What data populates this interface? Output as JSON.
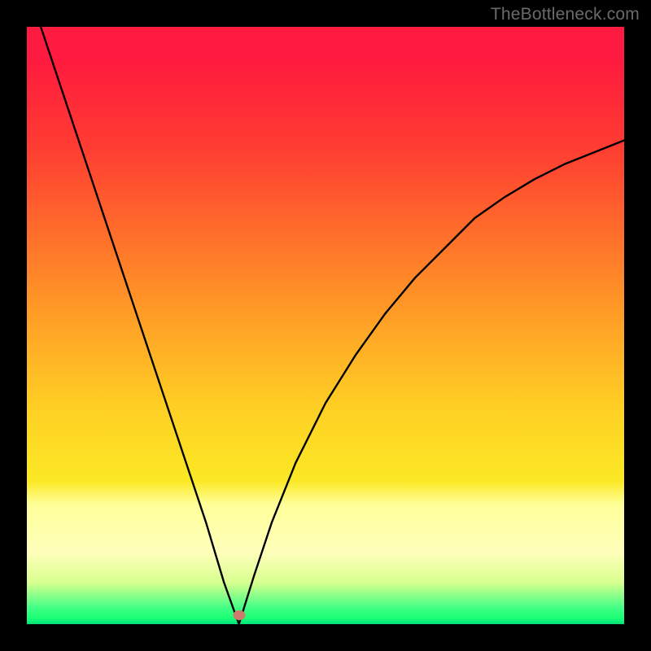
{
  "watermark": "TheBottleneck.com",
  "marker": {
    "x_frac": 0.355,
    "y_frac": 0.985,
    "color": "#cd7b6e"
  },
  "chart_data": {
    "type": "line",
    "title": "",
    "xlabel": "",
    "ylabel": "",
    "xlim": [
      0,
      100
    ],
    "ylim": [
      0,
      100
    ],
    "notch_x": 35.5,
    "series": [
      {
        "name": "bottleneck-curve",
        "x": [
          0,
          5,
          10,
          15,
          20,
          25,
          30,
          33,
          35.5,
          38,
          41,
          45,
          50,
          55,
          60,
          65,
          70,
          75,
          80,
          85,
          90,
          95,
          100
        ],
        "values": [
          107,
          92,
          77,
          62,
          47,
          32,
          17,
          7,
          0,
          8,
          17,
          27,
          37,
          45,
          52,
          58,
          63,
          68,
          71.5,
          74.5,
          77,
          79,
          81
        ]
      }
    ],
    "annotations": [
      {
        "type": "marker",
        "x": 35.5,
        "y": 1.5,
        "color": "#cd7b6e"
      }
    ],
    "legend": false,
    "grid": false,
    "background_gradient": {
      "type": "vertical",
      "stops": [
        {
          "pos": 0.0,
          "color": "#ff1a3f"
        },
        {
          "pos": 0.2,
          "color": "#ff3c32"
        },
        {
          "pos": 0.35,
          "color": "#ff6f2a"
        },
        {
          "pos": 0.5,
          "color": "#ffa326"
        },
        {
          "pos": 0.64,
          "color": "#ffd024"
        },
        {
          "pos": 0.76,
          "color": "#fbe824"
        },
        {
          "pos": 0.88,
          "color": "#ffffbb"
        },
        {
          "pos": 0.97,
          "color": "#3bff84"
        },
        {
          "pos": 1.0,
          "color": "#00e07a"
        }
      ]
    }
  }
}
